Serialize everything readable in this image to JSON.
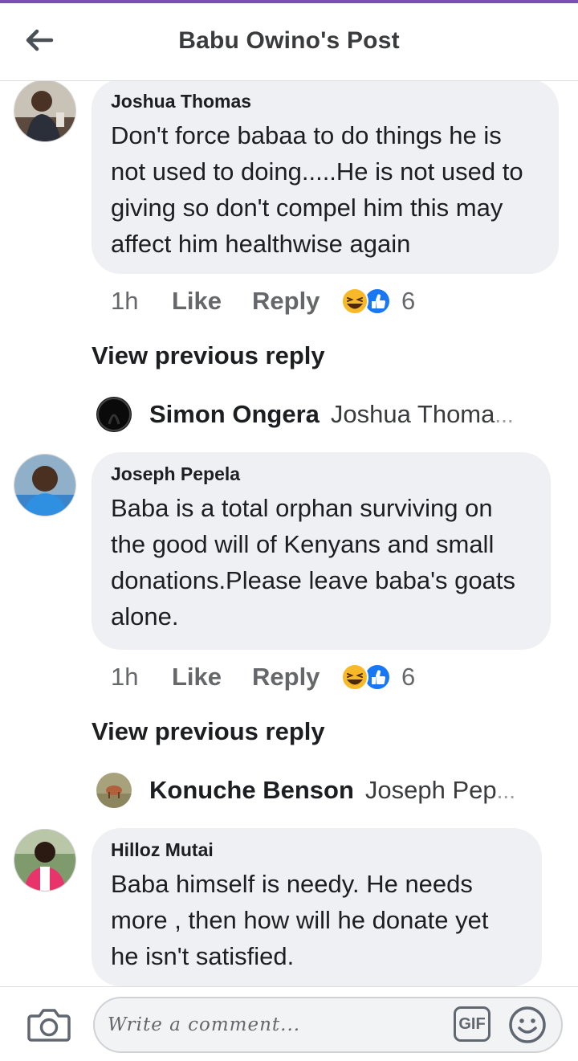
{
  "header": {
    "title": "Babu Owino's Post",
    "back_icon": "back-arrow-icon"
  },
  "comments": [
    {
      "author": "Joshua Thomas",
      "text": "Don't force babaa to do things he is not used to doing.....He is not used to giving so don't compel him this may affect him healthwise again",
      "time": "1h",
      "like": "Like",
      "reply": "Reply",
      "reaction_count": "6",
      "view_previous": "View previous reply",
      "subreply": {
        "author": "Simon Ongera",
        "text": "Joshua Thoma",
        "ellipsis": "..."
      }
    },
    {
      "author": "Joseph Pepela",
      "text": "Baba is a total orphan surviving on the good will of Kenyans and small donations.Please leave baba's goats alone.",
      "time": "1h",
      "like": "Like",
      "reply": "Reply",
      "reaction_count": "6",
      "view_previous": "View previous reply",
      "subreply": {
        "author": "Konuche Benson",
        "text": "Joseph Pep",
        "ellipsis": "..."
      }
    },
    {
      "author": "Hilloz Mutai",
      "text": "Baba himself is needy. He needs more , then how will he donate yet he isn't satisfied."
    }
  ],
  "composer": {
    "placeholder": "Write a comment...",
    "gif_label": "GIF"
  },
  "colors": {
    "accent": "#7b4fb5",
    "bubble": "#eff0f3",
    "like_blue": "#1877f2",
    "haha_yellow": "#f7b928"
  }
}
